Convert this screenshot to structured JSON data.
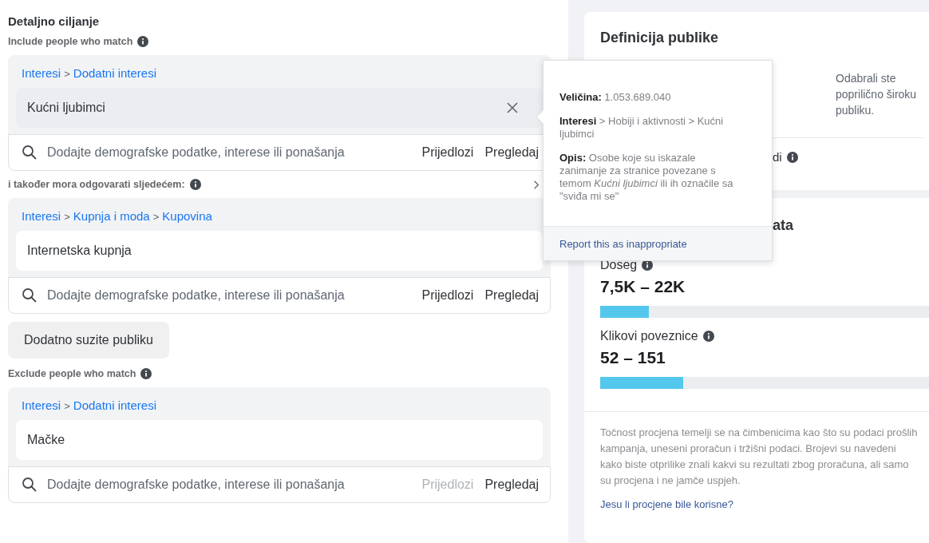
{
  "section_title": "Detaljno ciljanje",
  "blocks": [
    {
      "kind": "label",
      "text": "Include people who match"
    },
    {
      "kind": "group",
      "path": [
        {
          "text": "Interesi",
          "link": true
        },
        {
          "text": ">",
          "link": false
        },
        {
          "text": "Dodatni interesi",
          "link": true
        }
      ],
      "items": [
        {
          "text": "Kućni ljubimci",
          "hovered": true
        }
      ],
      "search": {
        "placeholder": "Dodajte demografske podatke, interese ili ponašanja",
        "suggestions": "Prijedlozi",
        "suggestions_disabled": false,
        "browse": "Pregledaj"
      }
    },
    {
      "kind": "expandable_label",
      "text": "i također mora odgovarati sljedećem:"
    },
    {
      "kind": "group",
      "path": [
        {
          "text": "Interesi",
          "link": true
        },
        {
          "text": ">",
          "link": false
        },
        {
          "text": "Kupnja i moda",
          "link": true
        },
        {
          "text": ">",
          "link": false
        },
        {
          "text": "Kupovina",
          "link": true
        }
      ],
      "items": [
        {
          "text": "Internetska kupnja",
          "hovered": false
        }
      ],
      "search": {
        "placeholder": "Dodajte demografske podatke, interese ili ponašanja",
        "suggestions": "Prijedlozi",
        "suggestions_disabled": false,
        "browse": "Pregledaj"
      }
    },
    {
      "kind": "button",
      "text": "Dodatno suzite publiku"
    },
    {
      "kind": "label",
      "text": "Exclude people who match"
    },
    {
      "kind": "group",
      "path": [
        {
          "text": "Interesi",
          "link": true
        },
        {
          "text": ">",
          "link": false
        },
        {
          "text": "Dodatni interesi",
          "link": true
        }
      ],
      "items": [
        {
          "text": "Mačke",
          "hovered": false
        }
      ],
      "search": {
        "placeholder": "Dodajte demografske podatke, interese ili ponašanja",
        "suggestions": "Prijedlozi",
        "suggestions_disabled": true,
        "browse": "Pregledaj"
      }
    }
  ],
  "tooltip": {
    "size": "**Veličina:** 1.053.689.040",
    "path": "**Interesi** > Hobiji i aktivnosti > Kućni ljubimci",
    "description": "**Opis:** Osobe koje su iskazale zanimanje za stranice povezane s temom *Kućni ljubimci* ili ih označile sa \"sviđa mi se\"",
    "report_link": "Report this as inappropriate"
  },
  "definition_card": {
    "title": "Definicija publike",
    "note": "Odabrali ste poprilično široku publiku.",
    "partial_label": "di"
  },
  "results_card": {
    "title_partial": "ata",
    "metrics": [
      {
        "label": "Doseg",
        "value": "7,5K – 22K",
        "level": 0.14
      },
      {
        "label": "Klikovi poveznice",
        "value": "52 – 151",
        "level": 0.24
      }
    ],
    "disclaimer": "Točnost procjena temelji se na čimbenicima kao što su podaci prošlih kampanja, uneseni proračun i tržišni podaci. Brojevi su navedeni kako biste otprilike znali kakvi su rezultati zbog proračuna, ali samo su procjena i ne jamče uspjeh.",
    "feedback_link": "Jesu li procjene bile korisne?"
  }
}
